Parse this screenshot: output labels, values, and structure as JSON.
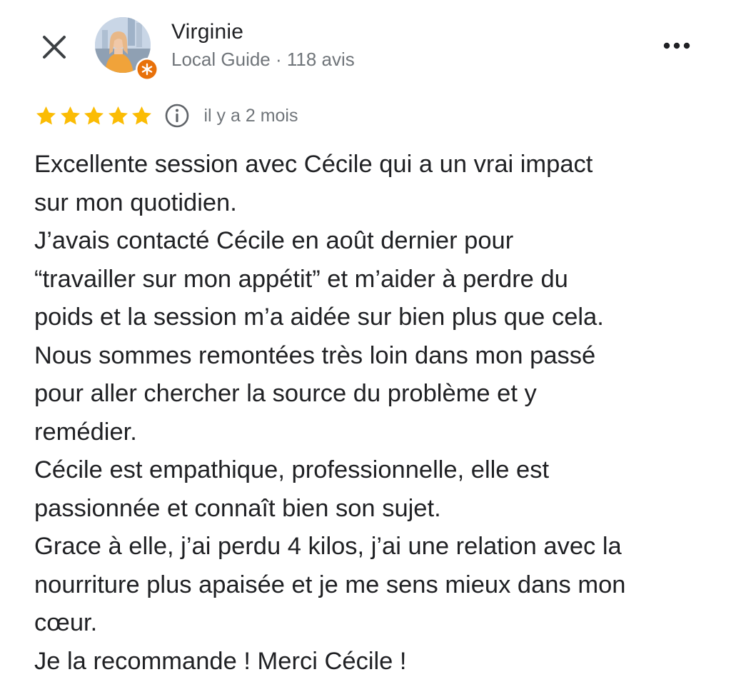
{
  "header": {
    "close_icon": "close-icon",
    "more_icon": "more-horizontal-icon",
    "avatar_icon": "user-avatar",
    "badge_icon": "local-guide-badge-icon",
    "user_name": "Virginie",
    "user_meta": "Local Guide · 118 avis"
  },
  "rating": {
    "stars": 5,
    "max_stars": 5,
    "star_color": "#fbbc04",
    "info_icon": "info-icon",
    "date": "il y a 2 mois"
  },
  "review": {
    "lines": [
      "Excellente session avec Cécile qui a un vrai impact",
      "sur mon quotidien.",
      "J’avais contacté Cécile en août dernier pour",
      "“travailler sur mon appétit” et m’aider à perdre du",
      "poids et la session m’a aidée sur bien plus que cela.",
      "Nous sommes remontées très loin dans mon passé",
      "pour aller chercher la source du problème et y",
      "remédier.",
      "Cécile est empathique, professionnelle, elle est",
      "passionnée et connaît bien son sujet.",
      "Grace à elle, j’ai perdu 4 kilos, j’ai une relation avec la",
      "nourriture plus apaisée et je me sens mieux dans mon",
      "cœur.",
      "Je la recommande ! Merci Cécile !"
    ]
  },
  "colors": {
    "text_primary": "#202124",
    "text_secondary": "#70757a",
    "badge_orange": "#e8710a",
    "star_yellow": "#fbbc04"
  }
}
